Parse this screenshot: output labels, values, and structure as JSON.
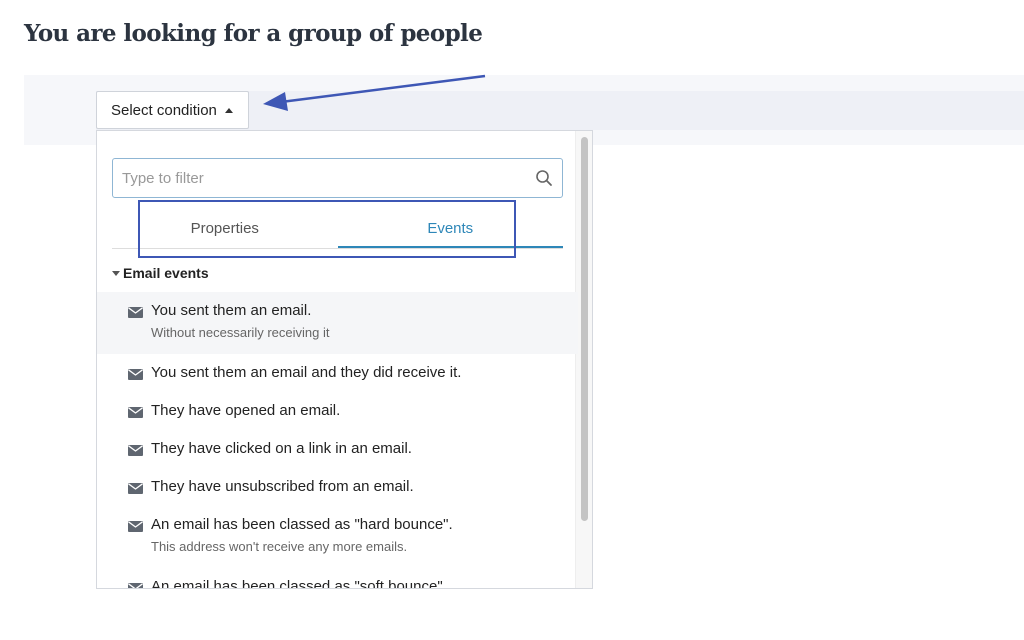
{
  "page": {
    "title": "You are looking for a group of people"
  },
  "condition": {
    "label": "Select condition"
  },
  "filter": {
    "placeholder": "Type to filter"
  },
  "tabs": [
    {
      "label": "Properties",
      "active": false
    },
    {
      "label": "Events",
      "active": true
    }
  ],
  "group": {
    "label": "Email events"
  },
  "items": [
    {
      "label": "You sent them an email.",
      "sub": "Without necessarily receiving it",
      "icon": "envelope-icon"
    },
    {
      "label": "You sent them an email and they did receive it.",
      "icon": "envelope-icon"
    },
    {
      "label": "They have opened an email.",
      "icon": "envelope-icon"
    },
    {
      "label": "They have clicked on a link in an email.",
      "icon": "envelope-icon"
    },
    {
      "label": "They have unsubscribed from an email.",
      "icon": "envelope-icon"
    },
    {
      "label": "An email has been classed as \"hard bounce\".",
      "sub": "This address won't receive any more emails.",
      "icon": "envelope-icon"
    },
    {
      "label": "An email has been classed as \"soft bounce\".",
      "icon": "envelope-icon"
    }
  ],
  "colors": {
    "accent": "#2e87b8",
    "annotation": "#3e57b5",
    "band": "#f6f7fa"
  }
}
